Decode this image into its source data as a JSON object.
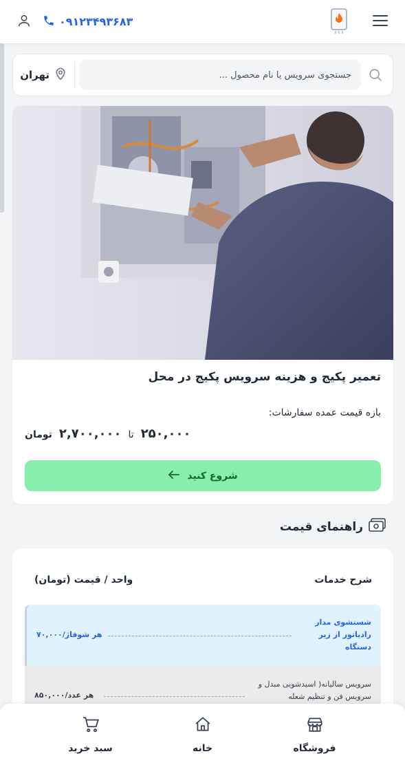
{
  "header": {
    "phone": "۰۹۱۲۳۴۹۳۶۸۳",
    "icons": [
      "user-icon",
      "phone-icon",
      "logo-boiler",
      "hamburger-menu-icon"
    ],
    "accent": "#2563eb"
  },
  "search": {
    "placeholder": "جستجوی سرویس یا نام محصول ...",
    "city": "تهران"
  },
  "product": {
    "title": "تعمیر پکیج و هزینه سرویس پکیج در محل",
    "range_label": "بازه قیمت عمده سفارشات:",
    "price_min": "۲۵۰,۰۰۰",
    "to": "تا",
    "price_max": "۲,۷۰۰,۰۰۰",
    "currency": "تومان",
    "start_button": "شروع کنید",
    "button_color": "#86efac"
  },
  "price_guide": {
    "title": "راهنمای قیمت",
    "col_service": "شرح خدمات",
    "col_unit": "واحد / قیمت (تومان)",
    "rows": [
      {
        "name": "شستشوی مدار رادیاتور از زیر دستگاه",
        "price": "هر شوفاژ/۷۰,۰۰۰"
      },
      {
        "name": "سرویس سالیانه( اسیدشویی مبدل و سرویس فن و تنظیم شعله",
        "price": "هر عدد/۸۵۰,۰۰۰"
      }
    ]
  },
  "bottom_nav": {
    "shop": "فروشگاه",
    "home": "خانه",
    "cart": "سبد خرید"
  }
}
